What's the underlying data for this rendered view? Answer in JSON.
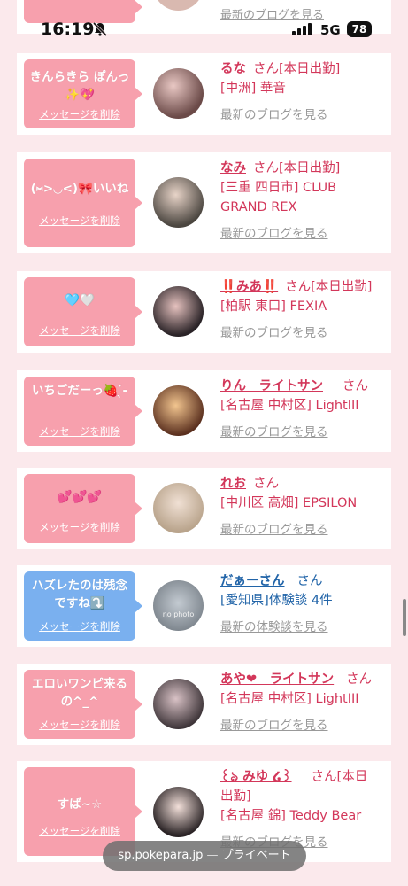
{
  "status": {
    "time": "16:19",
    "network": "5G",
    "battery": "78"
  },
  "top_partial": {
    "blog_link": "最新のブログを見る"
  },
  "cards": [
    {
      "msg": "きんらきら ぽんっ✨💖",
      "delete": "メッセージを削除",
      "name": "るな",
      "san": "さん",
      "tag": "[本日出勤]",
      "shop": "[中洲] 華音",
      "link": "最新のブログを見る"
    },
    {
      "msg": "(⑅>◡<)🎀いいね",
      "delete": "メッセージを削除",
      "name": "なみ",
      "san": "さん",
      "tag": "[本日出勤]",
      "shop": "[三重 四日市] CLUB GRAND REX",
      "link": "最新のブログを見る"
    },
    {
      "msg": "🩵🤍",
      "delete": "メッセージを削除",
      "name": "‼️みあ‼️",
      "san": "さん",
      "tag": "[本日出勤]",
      "shop": "[柏駅 東口] FEXIA",
      "link": "最新のブログを見る"
    },
    {
      "msg": "いちごだーっ🍓 ̖́-",
      "delete": "メッセージを削除",
      "name": "りん　ライトサン",
      "san": "さん",
      "tag": "",
      "shop": "[名古屋 中村区] LightIII",
      "link": "最新のブログを見る"
    },
    {
      "msg": "💕💕💕",
      "delete": "メッセージを削除",
      "name": "れお",
      "san": "さん",
      "tag": "",
      "shop": "[中川区 高畑] EPSILON",
      "link": "最新のブログを見る"
    },
    {
      "msg": "ハズレたのは残念ですね⤵️",
      "delete": "メッセージを削除",
      "name": "だぁーさん",
      "san": "さん",
      "tag": "",
      "shop": "[愛知県]体験談 4件",
      "link": "最新の体験談を見る",
      "avatar_text": "no photo"
    },
    {
      "msg": "エロいワンピ来るの^_^",
      "delete": "メッセージを削除",
      "name": "あや❤︎　ライトサン",
      "san": "さん",
      "tag": "",
      "shop": "[名古屋 中村区] LightIII",
      "link": "最新のブログを見る"
    },
    {
      "msg": "すば~☆",
      "delete": "メッセージを削除",
      "name": "꒰ঌ みゆ ໒꒱",
      "san": "さん",
      "tag": "[本日出勤]",
      "shop": "[名古屋 錦] Teddy Bear",
      "link": "最新のブログを見る"
    }
  ],
  "bottom": {
    "url": "sp.pokepara.jp",
    "sep": "—",
    "mode": "プライベート"
  }
}
